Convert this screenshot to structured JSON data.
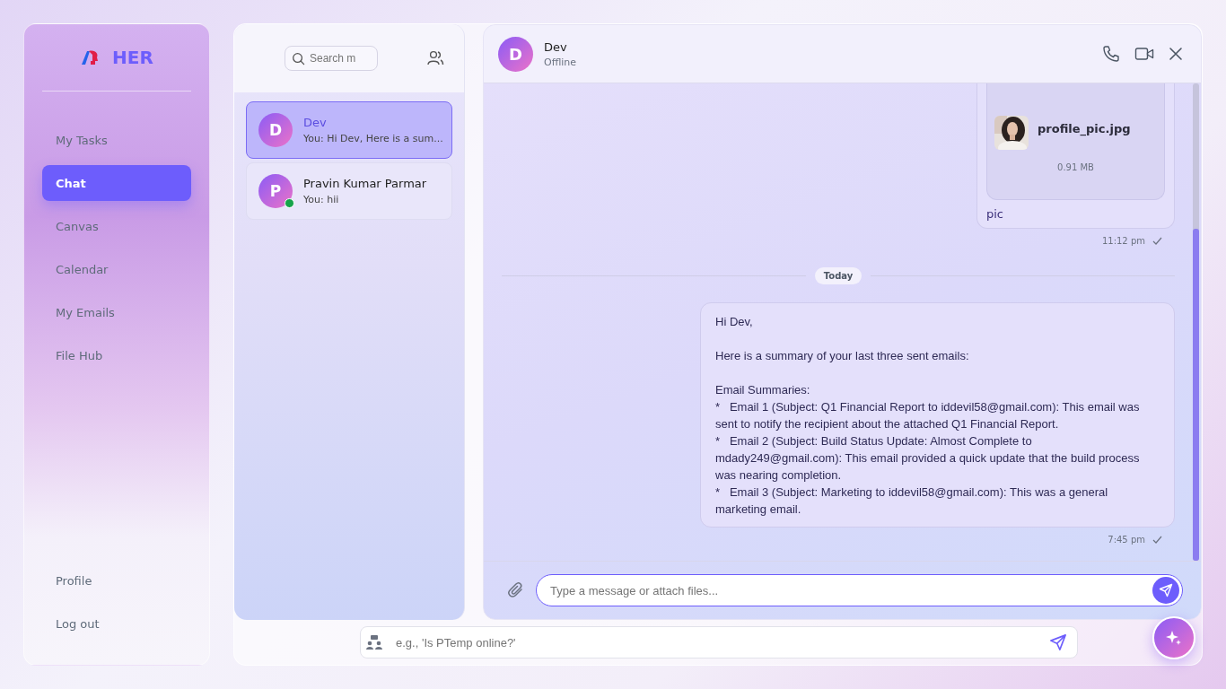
{
  "sidebar": {
    "brand": "HER",
    "nav": [
      {
        "label": "My Tasks",
        "selected": false
      },
      {
        "label": "Chat",
        "selected": true
      },
      {
        "label": "Canvas",
        "selected": false
      },
      {
        "label": "Calendar",
        "selected": false
      },
      {
        "label": "My Emails",
        "selected": false
      },
      {
        "label": "File Hub",
        "selected": false
      }
    ],
    "bottom": [
      {
        "label": "Profile"
      },
      {
        "label": "Log out"
      }
    ]
  },
  "contacts": {
    "search": {
      "placeholder": "Search m"
    },
    "items": [
      {
        "initial": "D",
        "name": "Dev",
        "preview": "You: Hi Dev, Here is a sum...",
        "selected": true,
        "online": false
      },
      {
        "initial": "P",
        "name": "Pravin Kumar Parmar",
        "preview": "You: hii",
        "selected": false,
        "online": true
      }
    ]
  },
  "chat": {
    "header": {
      "initial": "D",
      "name": "Dev",
      "status": "Offline"
    },
    "messages": [
      {
        "kind": "file",
        "file_name": "profile_pic.jpg",
        "file_size": "0.91 MB",
        "caption": "pic",
        "time": "11:12 pm"
      },
      {
        "kind": "divider",
        "label": "Today"
      },
      {
        "kind": "text",
        "greeting": "Hi Dev,",
        "intro": "Here is a summary of your last three sent emails:",
        "heading": "Email Summaries:",
        "bullets": [
          {
            "marker": "*",
            "text": "Email 1 (Subject: Q1 Financial Report to iddevil58@gmail.com): This email was sent to notify the recipient about the attached Q1 Financial Report."
          },
          {
            "marker": "*",
            "text": "Email 2 (Subject: Build Status Update: Almost Complete to mdady249@gmail.com): This email provided a quick update that the build process was nearing completion."
          },
          {
            "marker": "*",
            "text": "Email 3 (Subject: Marketing to iddevil58@gmail.com): This was a general marketing email."
          }
        ],
        "time": "7:45 pm"
      }
    ],
    "composer": {
      "placeholder": "Type a message or attach files..."
    }
  },
  "assistant": {
    "placeholder": "e.g., 'Is PTemp online?'"
  }
}
